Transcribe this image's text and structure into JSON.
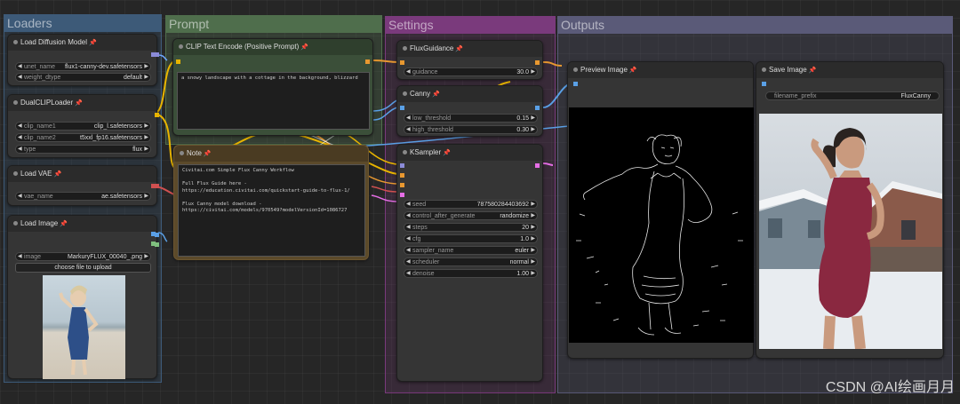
{
  "groups": {
    "loaders": "Loaders",
    "prompt": "Prompt",
    "settings": "Settings",
    "outputs": "Outputs"
  },
  "colors": {
    "loaders": "#3d5a78",
    "prompt": "#4f6e4c",
    "settings": "#7a3a7c",
    "outputs": "#5a5a78",
    "clip_node": "#3b4f39",
    "note_node": "#5c4a2a",
    "pin": "#e64a3d",
    "wire_yellow": "#e8b400",
    "wire_blue": "#5aa0e6",
    "wire_red": "#d05050",
    "wire_orange": "#e89830",
    "wire_pink": "#e66ee6"
  },
  "nodes": {
    "load_diffusion": {
      "title": "Load Diffusion Model",
      "widgets": [
        {
          "label": "unet_name",
          "value": "flux1-canny-dev.safetensors"
        },
        {
          "label": "weight_dtype",
          "value": "default"
        }
      ]
    },
    "dual_clip": {
      "title": "DualCLIPLoader",
      "widgets": [
        {
          "label": "clip_name1",
          "value": "clip_l.safetensors"
        },
        {
          "label": "clip_name2",
          "value": "t5xxl_fp16.safetensors"
        },
        {
          "label": "type",
          "value": "flux"
        }
      ]
    },
    "load_vae": {
      "title": "Load VAE",
      "widgets": [
        {
          "label": "vae_name",
          "value": "ae.safetensors"
        }
      ]
    },
    "load_image": {
      "title": "Load Image",
      "widgets": [
        {
          "label": "image",
          "value": "MarkuryFLUX_00040_.png"
        }
      ],
      "upload_button": "choose file to upload"
    },
    "clip_text": {
      "title": "CLIP Text Encode (Positive Prompt)",
      "text": "a snowy landscape with a cottage in the background, blizzard"
    },
    "note": {
      "title": "Note",
      "text": "Civitai.com Simple Flux Canny Workflow\n\nFull Flux Guide here - https://education.civitai.com/quickstart-guide-to-flux-1/\n\nFlux Canny model download - https://civitai.com/models/970549?modelVersionId=1086727"
    },
    "flux_guidance": {
      "title": "FluxGuidance",
      "widgets": [
        {
          "label": "guidance",
          "value": "30.0"
        }
      ]
    },
    "canny": {
      "title": "Canny",
      "widgets": [
        {
          "label": "low_threshold",
          "value": "0.15"
        },
        {
          "label": "high_threshold",
          "value": "0.30"
        }
      ]
    },
    "ksampler": {
      "title": "KSampler",
      "widgets": [
        {
          "label": "seed",
          "value": "787580284403692"
        },
        {
          "label": "control_after_generate",
          "value": "randomize"
        },
        {
          "label": "steps",
          "value": "20"
        },
        {
          "label": "cfg",
          "value": "1.0"
        },
        {
          "label": "sampler_name",
          "value": "euler"
        },
        {
          "label": "scheduler",
          "value": "normal"
        },
        {
          "label": "denoise",
          "value": "1.00"
        }
      ]
    },
    "preview_image": {
      "title": "Preview Image"
    },
    "save_image": {
      "title": "Save Image",
      "widgets": [
        {
          "label": "filename_prefix",
          "value": "FluxCanny"
        }
      ]
    }
  },
  "watermark": "CSDN @AI绘画月月"
}
